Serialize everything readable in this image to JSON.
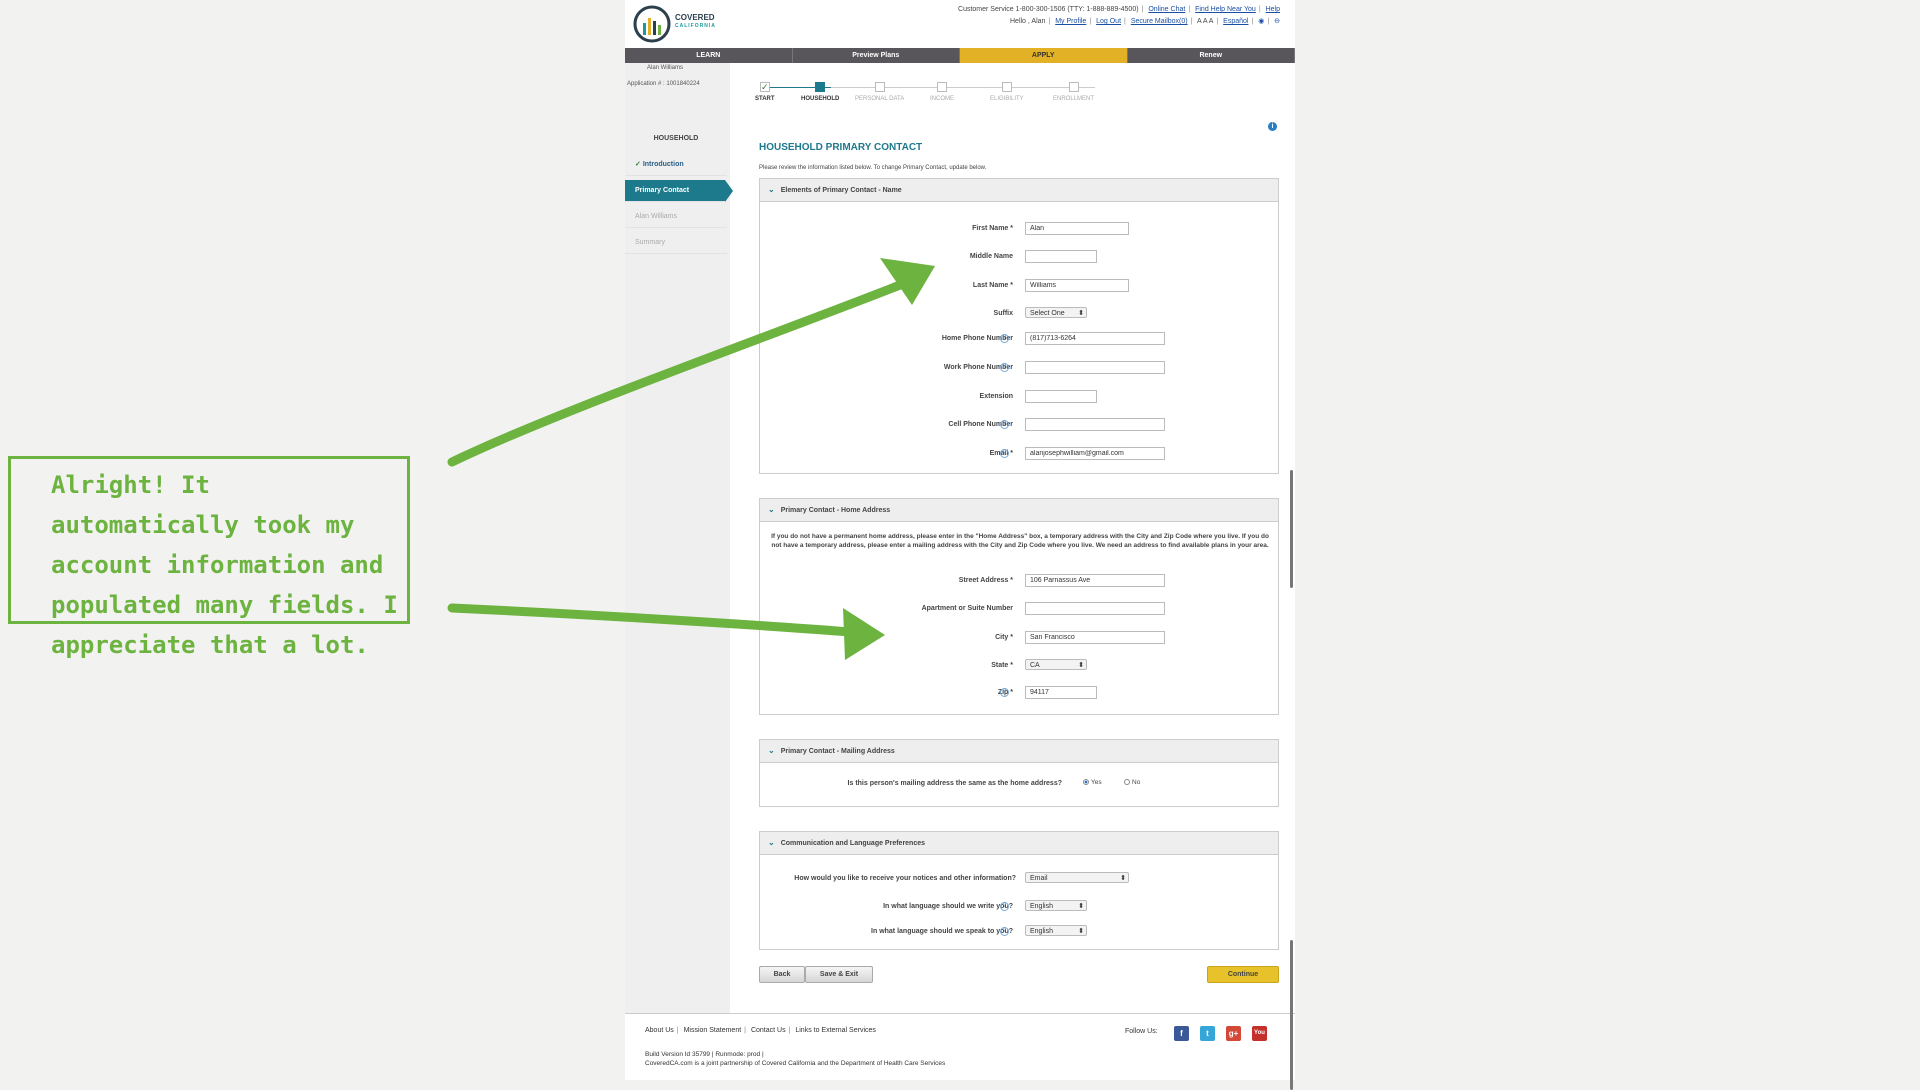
{
  "header": {
    "logo_name": "COVERED",
    "logo_sub": "CALIFORNIA",
    "customer_service": "Customer Service 1-800-300-1506 (TTY: 1-888-889-4500)",
    "online_chat": "Online Chat",
    "find_help": "Find Help Near You",
    "help": "Help",
    "greeting": "Hello , Alan",
    "my_profile": "My Profile",
    "log_out": "Log Out",
    "secure_mailbox": "Secure Mailbox(0)",
    "text_size": "A A A",
    "espanol": "Español"
  },
  "nav": {
    "learn": "LEARN",
    "preview": "Preview Plans",
    "apply": "APPLY",
    "renew": "Renew"
  },
  "sidebar": {
    "user": "Alan Williams",
    "application": "Application # : 1001840224",
    "section": "HOUSEHOLD",
    "items": [
      "Introduction",
      "Primary Contact",
      "Alan Williams",
      "Summary"
    ]
  },
  "steps": [
    "START",
    "HOUSEHOLD",
    "PERSONAL DATA",
    "INCOME",
    "ELIGIBILITY",
    "ENROLLMENT"
  ],
  "page": {
    "title": "HOUSEHOLD PRIMARY CONTACT",
    "intro": "Please review the information listed below. To change Primary Contact, update below."
  },
  "name_panel": {
    "heading": "Elements of Primary Contact - Name",
    "first_name_label": "First Name *",
    "first_name": "Alan",
    "middle_name_label": "Middle Name",
    "middle_name": "",
    "last_name_label": "Last Name *",
    "last_name": "Williams",
    "suffix_label": "Suffix",
    "suffix": "Select One",
    "home_phone_label": "Home Phone Number",
    "home_phone": "(817)713-6264",
    "work_phone_label": "Work Phone Number",
    "work_phone": "",
    "extension_label": "Extension",
    "extension": "",
    "cell_phone_label": "Cell Phone Number",
    "cell_phone": "",
    "email_label": "Email *",
    "email": "alanjosephwilliam@gmail.com"
  },
  "address_panel": {
    "heading": "Primary Contact - Home Address",
    "note": "If you do not have a permanent home address, please enter in the \"Home Address\" box, a temporary address with the City and Zip Code where you live. If you do not have a temporary address, please enter a mailing address with the City and Zip Code where you live. We need an address to find available plans in your area.",
    "street_label": "Street Address *",
    "street": "106 Parnassus Ave",
    "apt_label": "Apartment or Suite Number",
    "apt": "",
    "city_label": "City *",
    "city": "San Francisco",
    "state_label": "State *",
    "state": "CA",
    "zip_label": "Zip *",
    "zip": "94117"
  },
  "mailing_panel": {
    "heading": "Primary Contact - Mailing Address",
    "question": "Is this person's mailing address the same as the home address?",
    "yes": "Yes",
    "no": "No",
    "selected": "Yes"
  },
  "comm_panel": {
    "heading": "Communication and Language Preferences",
    "notices_label": "How would you like to receive your notices and other information?",
    "notices": "Email",
    "write_label": "In what language should we write you?",
    "write": "English",
    "speak_label": "In what language should we speak to you?",
    "speak": "English"
  },
  "buttons": {
    "back": "Back",
    "save_exit": "Save & Exit",
    "continue": "Continue"
  },
  "footer": {
    "about": "About Us",
    "mission": "Mission Statement",
    "contact": "Contact Us",
    "links": "Links to External Services",
    "build": "Build Version Id 35799 | Runmode: prod |",
    "partnership": "CoveredCA.com is a joint partnership of Covered California and the Department of Health Care Services",
    "follow": "Follow Us:"
  },
  "annotation": {
    "text": "Alright! It automatically took my account information and populated many fields. I appreciate that a lot.",
    "color": "#6db33f"
  }
}
